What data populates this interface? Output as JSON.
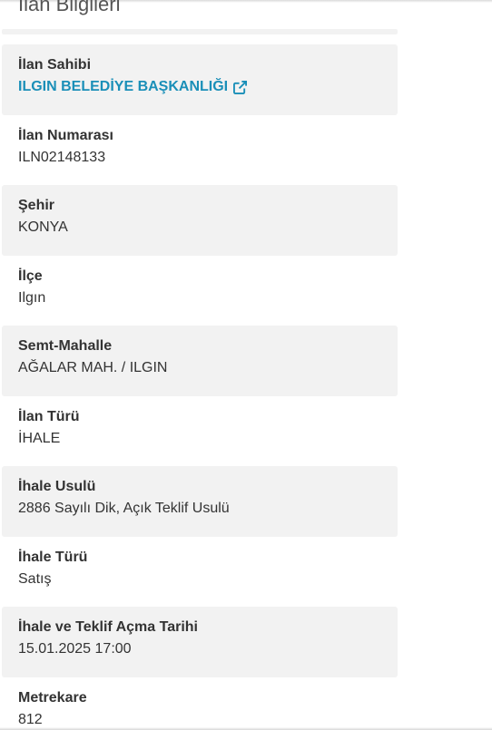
{
  "section": {
    "title": "İlan Bilgileri"
  },
  "colors": {
    "link": "#1a8fb8",
    "shaded_row": "#f2f2f2"
  },
  "owner": {
    "label": "İlan Sahibi",
    "name": "ILGIN BELEDİYE BAŞKANLIĞI",
    "icon": "external-link-icon"
  },
  "fields": {
    "ilan_numarasi": {
      "label": "İlan Numarası",
      "value": "ILN02148133"
    },
    "sehir": {
      "label": "Şehir",
      "value": "KONYA"
    },
    "ilce": {
      "label": "İlçe",
      "value": "Ilgın"
    },
    "semt_mahalle": {
      "label": "Semt-Mahalle",
      "value": "AĞALAR MAH. / ILGIN"
    },
    "ilan_turu": {
      "label": "İlan Türü",
      "value": "İHALE"
    },
    "ihale_usulu": {
      "label": "İhale Usulü",
      "value": "2886 Sayılı Dik, Açık Teklif Usulü"
    },
    "ihale_turu": {
      "label": "İhale Türü",
      "value": "Satış"
    },
    "ihale_tarihi": {
      "label": "İhale ve Teklif Açma Tarihi",
      "value": "15.01.2025 17:00"
    },
    "metrekare": {
      "label": "Metrekare",
      "value": "812"
    }
  }
}
